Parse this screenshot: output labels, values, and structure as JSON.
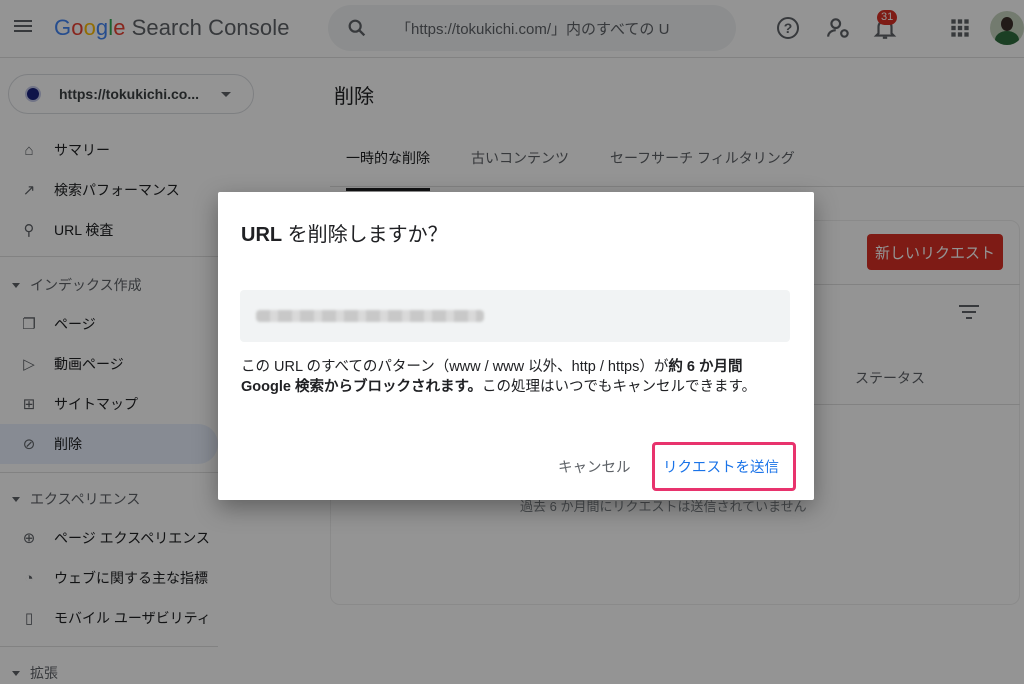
{
  "header": {
    "logo_google": [
      "G",
      "o",
      "o",
      "g",
      "l",
      "e"
    ],
    "product": "Search Console",
    "search_value": "「https://tokukichi.com/」内のすべての U",
    "notification_count": "31"
  },
  "sidebar": {
    "property": "https://tokukichi.co...",
    "items": [
      {
        "label": "サマリー"
      },
      {
        "label": "検索パフォーマンス"
      },
      {
        "label": "URL 検査"
      }
    ],
    "section_index": "インデックス作成",
    "index_items": [
      {
        "label": "ページ"
      },
      {
        "label": "動画ページ"
      },
      {
        "label": "サイトマップ"
      },
      {
        "label": "削除"
      }
    ],
    "section_experience": "エクスペリエンス",
    "experience_items": [
      {
        "label": "ページ エクスペリエンス"
      },
      {
        "label": "ウェブに関する主な指標"
      },
      {
        "label": "モバイル ユーザビリティ"
      }
    ],
    "section_extensions": "拡張"
  },
  "main": {
    "title": "削除",
    "tabs": [
      {
        "label": "一時的な削除"
      },
      {
        "label": "古いコンテンツ"
      },
      {
        "label": "セーフサーチ フィルタリング"
      }
    ],
    "new_request": "新しいリクエスト",
    "status_col": "ステータス",
    "empty_message": "過去 6 か月間にリクエストは送信されていません"
  },
  "dialog": {
    "title_prefix": "URL",
    "title_rest": " を削除しますか？",
    "body_1": "この URL のすべてのパターン（www / www 以外、http / https）が",
    "body_bold": "約 6 か月間 Google 検索からブロックされます。",
    "body_2": "この処理はいつでもキャンセルできます。",
    "cancel": "キャンセル",
    "submit": "リクエストを送信"
  },
  "colors": {
    "accent_red": "#d93025",
    "highlight_pink": "#e8336d",
    "link_blue": "#1a73e8"
  }
}
